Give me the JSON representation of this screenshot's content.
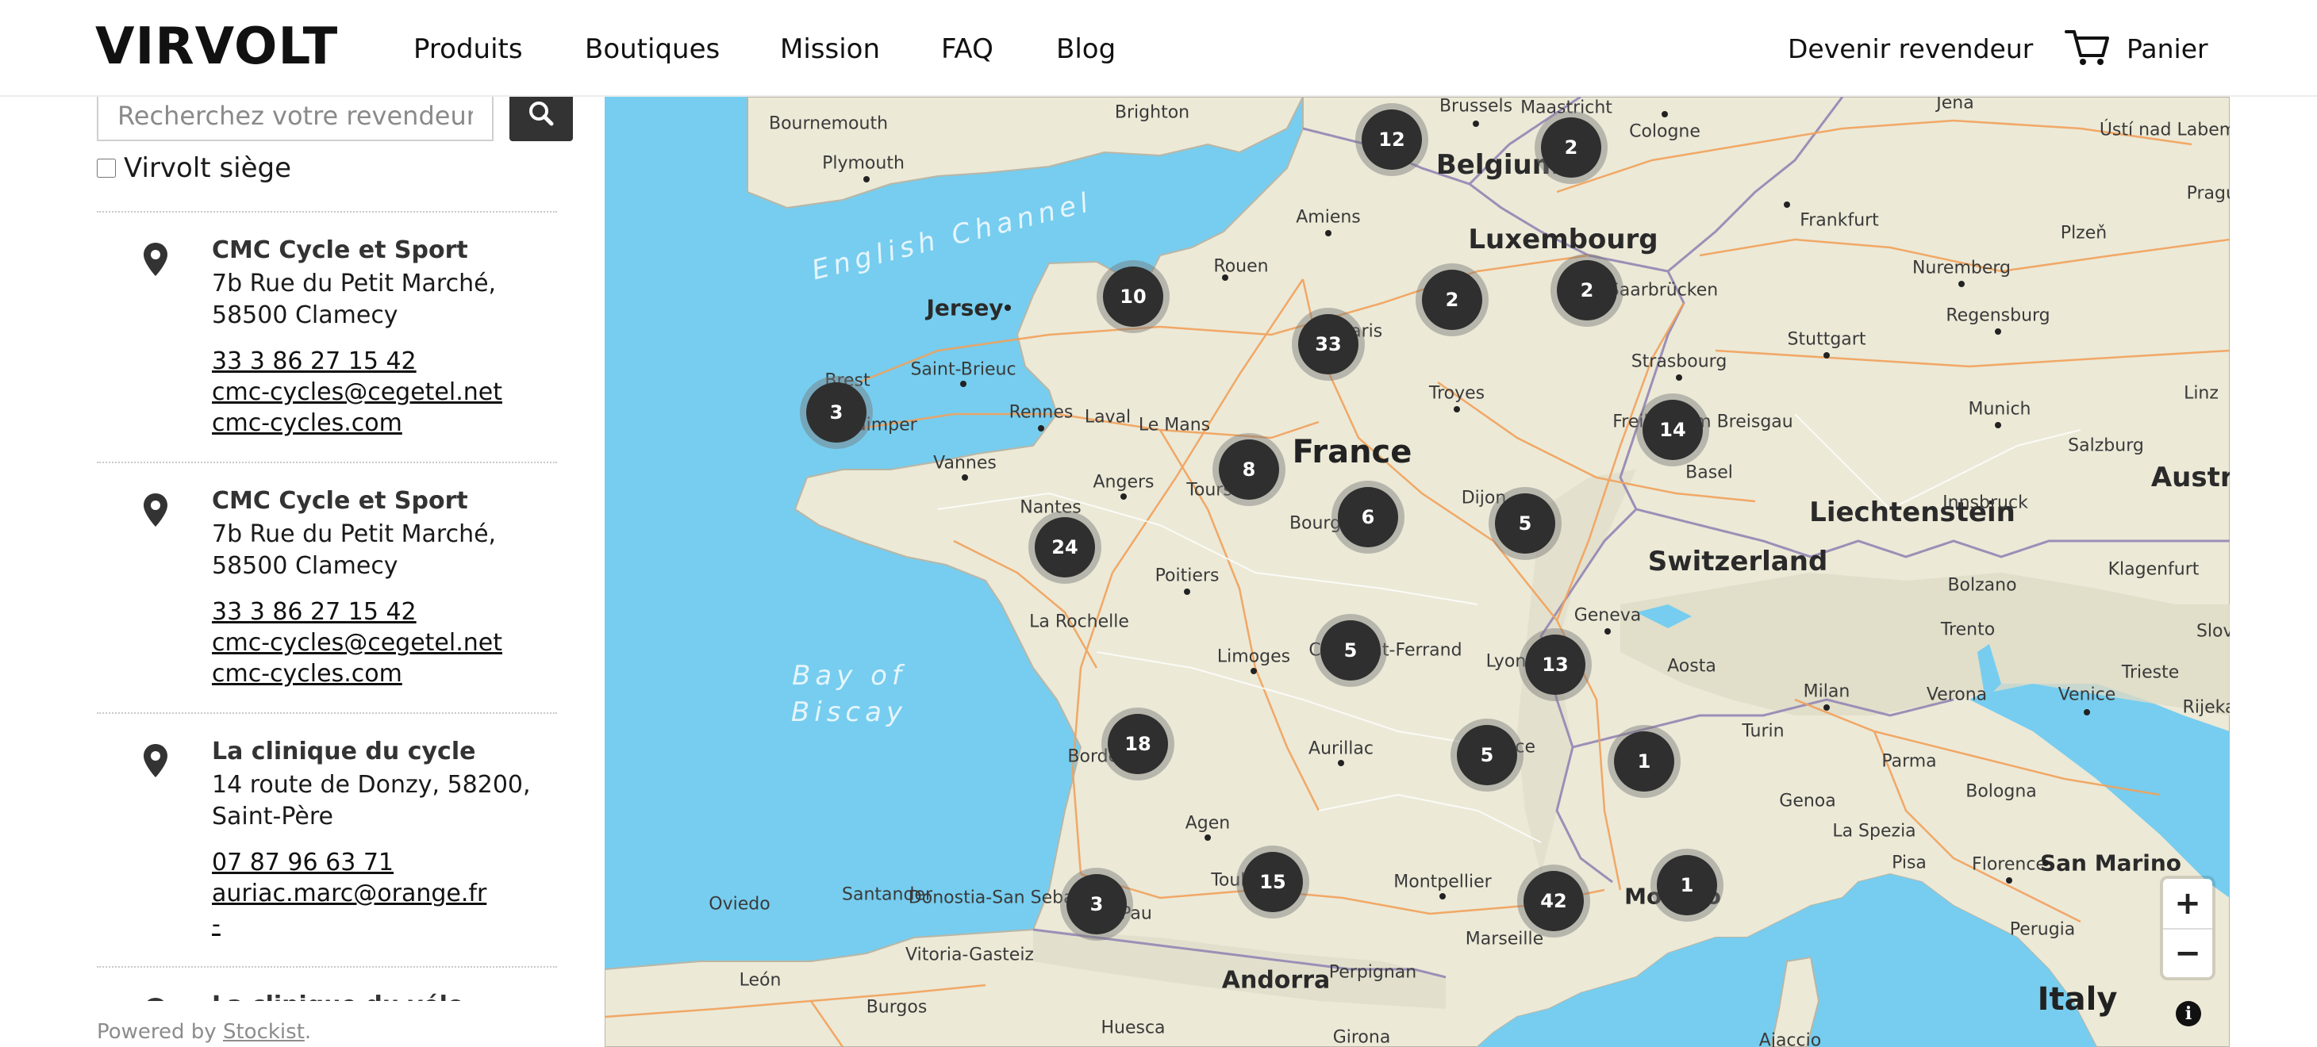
{
  "header": {
    "logo": "VIRVOLT",
    "nav": [
      "Produits",
      "Boutiques",
      "Mission",
      "FAQ",
      "Blog"
    ],
    "become_reseller": "Devenir revendeur",
    "cart_label": "Panier",
    "cart_icon": "cart-icon"
  },
  "search": {
    "placeholder": "Recherchez votre revendeur",
    "value": "",
    "button_icon": "search-icon"
  },
  "filter": {
    "checkbox_label": "Virvolt siège",
    "checked": false
  },
  "stores": [
    {
      "name": "CMC Cycle et Sport",
      "address_line1": "7b Rue du Petit Marché,",
      "address_line2": "58500 Clamecy",
      "phone": "33 3 86 27 15 42",
      "email": "cmc-cycles@cegetel.net",
      "website": "cmc-cycles.com"
    },
    {
      "name": "CMC Cycle et Sport",
      "address_line1": "7b Rue du Petit Marché,",
      "address_line2": "58500 Clamecy",
      "phone": "33 3 86 27 15 42",
      "email": "cmc-cycles@cegetel.net",
      "website": "cmc-cycles.com"
    },
    {
      "name": "La clinique du cycle",
      "address_line1": "14 route de Donzy, 58200,",
      "address_line2": "Saint-Père",
      "phone": "07 87 96 63 71",
      "email": "auriac.marc@orange.fr",
      "website": "-"
    },
    {
      "name": "La clinique du vélo"
    }
  ],
  "footer": {
    "powered_prefix": "Powered by ",
    "powered_link": "Stockist",
    "powered_suffix": "."
  },
  "map": {
    "sea_labels": [
      "English Channel",
      "Bay of",
      "Biscay"
    ],
    "country_labels": [
      "France",
      "Belgium",
      "Luxembourg",
      "Switzerland",
      "Liechtenstein",
      "Austria",
      "Italy",
      "Andorra",
      "Monaco",
      "San Marino",
      "Jersey"
    ],
    "city_labels": [
      "Brussels",
      "Maastricht",
      "Cologne",
      "Jena",
      "Ústí nad Labem",
      "Prague",
      "Plzeň",
      "Frankfurt",
      "Nuremberg",
      "Regensburg",
      "Stuttgart",
      "Munich",
      "Linz",
      "Salzburg",
      "Innsbruck",
      "Klagenfurt",
      "Bolzano",
      "Trento",
      "Slove",
      "Trieste",
      "Rijeka",
      "Venice",
      "Verona",
      "Milan",
      "Aosta",
      "Turin",
      "Parma",
      "Bologna",
      "Genoa",
      "La Spezia",
      "Pisa",
      "Florence",
      "Perugia",
      "Ajaccio",
      "Bournemouth",
      "Brighton",
      "Plymouth",
      "Amiens",
      "Rouen",
      "Saint-Brieuc",
      "Rennes",
      "Laval",
      "Le Mans",
      "Vannes",
      "Angers",
      "Tours",
      "Nantes",
      "Poitiers",
      "La Rochelle",
      "Limoges",
      "Aurillac",
      "Agen",
      "Montpellier",
      "Marseille",
      "Perpignan",
      "Girona",
      "Huesca",
      "Burgos",
      "León",
      "Oviedo",
      "Santander",
      "Vitoria-Gasteiz",
      "Donostia-San Sebastián",
      "Troyes",
      "Dijon",
      "Strasbourg",
      "Freiburg im Breisgau",
      "Basel",
      "Saarbrücken",
      "Geneva",
      "Lyon",
      "Valence",
      "Clermont-Ferrand",
      "Bourges",
      "Quimper",
      "Brest",
      "Bordeaux",
      "Toulouse",
      "Pau",
      "Paris"
    ],
    "clusters": [
      12,
      2,
      10,
      2,
      2,
      33,
      3,
      14,
      8,
      6,
      5,
      24,
      5,
      13,
      18,
      5,
      1,
      15,
      3,
      42,
      1
    ],
    "zoom_in": "+",
    "zoom_out": "−",
    "info_icon": "info-icon"
  }
}
